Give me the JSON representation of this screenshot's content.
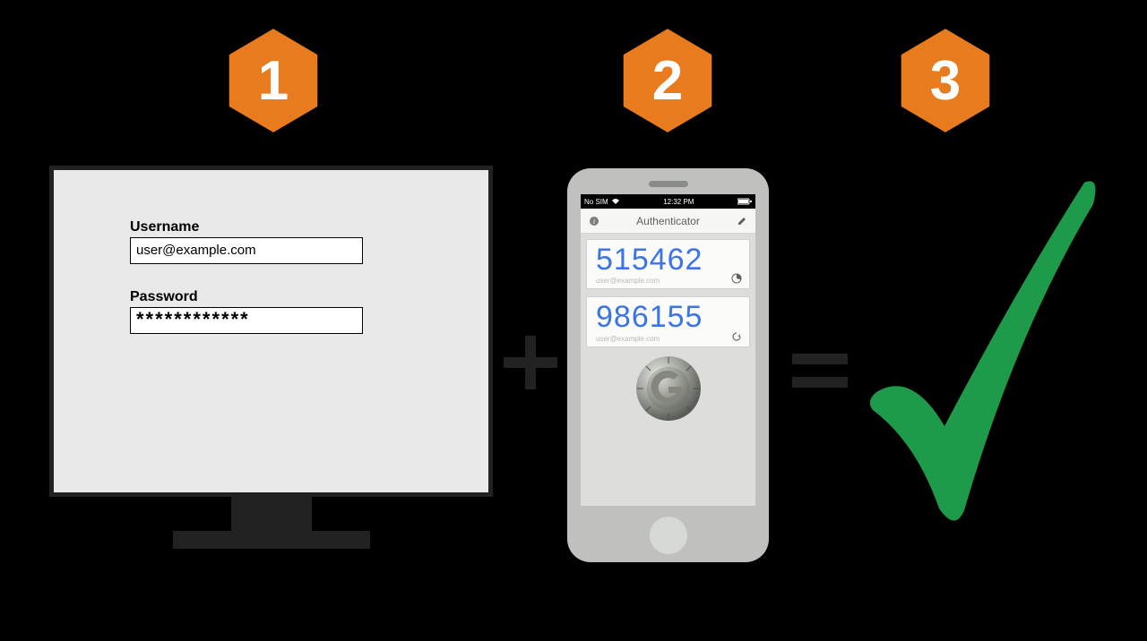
{
  "badges": {
    "one": "1",
    "two": "2",
    "three": "3"
  },
  "colors": {
    "hex": "#e87b1e",
    "check": "#1d9a4a",
    "code": "#3a74e8",
    "dark": "#222222"
  },
  "login": {
    "username_label": "Username",
    "username_value": "user@example.com",
    "password_label": "Password",
    "password_value": "************"
  },
  "phone": {
    "status": {
      "carrier": "No SIM",
      "time": "12:32 PM"
    },
    "app_title": "Authenticator",
    "codes": [
      {
        "value": "515462",
        "account": "user@example.com"
      },
      {
        "value": "986155",
        "account": "user@example.com"
      }
    ]
  }
}
